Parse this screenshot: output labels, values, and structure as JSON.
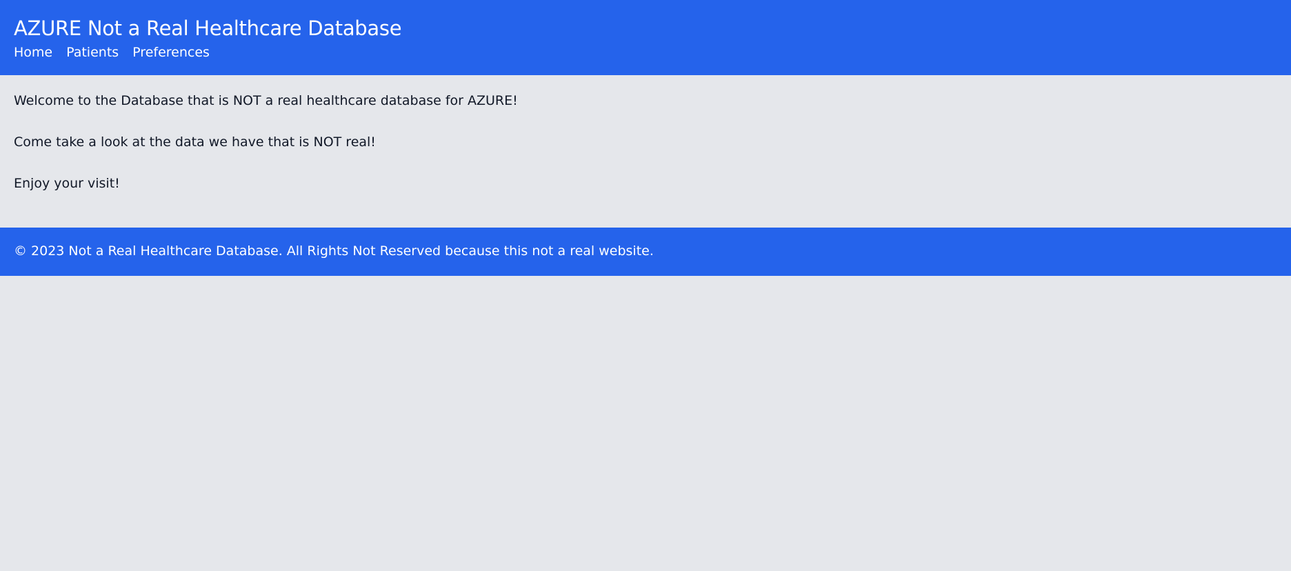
{
  "header": {
    "title": "AZURE Not a Real Healthcare Database",
    "nav": [
      {
        "label": "Home"
      },
      {
        "label": "Patients"
      },
      {
        "label": "Preferences"
      }
    ]
  },
  "main": {
    "paragraphs": [
      "Welcome to the Database that is NOT a real healthcare database for AZURE!",
      "Come take a look at the data we have that is NOT real!",
      "Enjoy your visit!"
    ]
  },
  "footer": {
    "text": "© 2023 Not a Real Healthcare Database. All Rights Not Reserved because this not a real website."
  },
  "colors": {
    "header_bg": "#2563eb",
    "page_bg": "#e5e7eb",
    "text": "#111827"
  }
}
